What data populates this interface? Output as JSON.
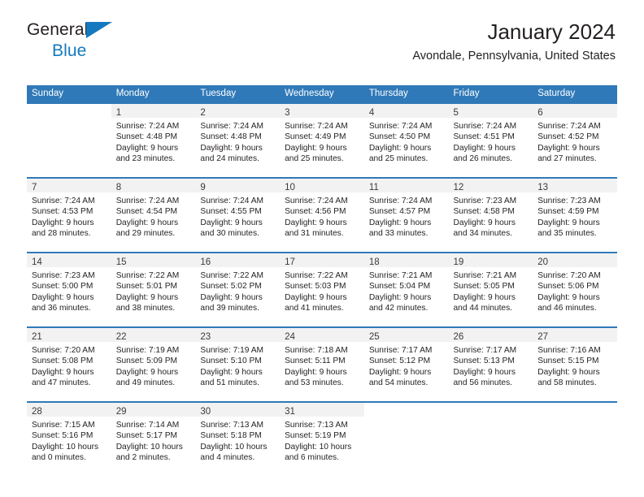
{
  "brand": {
    "name_top": "General",
    "name_bottom": "Blue",
    "triangle_icon": "blue-triangle-icon",
    "color_dark": "#231f20",
    "color_blue": "#1579c0"
  },
  "header": {
    "title": "January 2024",
    "subtitle": "Avondale, Pennsylvania, United States"
  },
  "theme": {
    "header_bg": "#3079b8",
    "header_text": "#ffffff",
    "daynum_band": "#f2f2f2",
    "row_rule": "#3079b8"
  },
  "weekday_headers": [
    "Sunday",
    "Monday",
    "Tuesday",
    "Wednesday",
    "Thursday",
    "Friday",
    "Saturday"
  ],
  "labels": {
    "sunrise": "Sunrise:",
    "sunset": "Sunset:",
    "daylight": "Daylight:"
  },
  "weeks": [
    [
      {
        "day": "",
        "lines": []
      },
      {
        "day": "1",
        "lines": [
          "Sunrise: 7:24 AM",
          "Sunset: 4:48 PM",
          "Daylight: 9 hours",
          "and 23 minutes."
        ]
      },
      {
        "day": "2",
        "lines": [
          "Sunrise: 7:24 AM",
          "Sunset: 4:48 PM",
          "Daylight: 9 hours",
          "and 24 minutes."
        ]
      },
      {
        "day": "3",
        "lines": [
          "Sunrise: 7:24 AM",
          "Sunset: 4:49 PM",
          "Daylight: 9 hours",
          "and 25 minutes."
        ]
      },
      {
        "day": "4",
        "lines": [
          "Sunrise: 7:24 AM",
          "Sunset: 4:50 PM",
          "Daylight: 9 hours",
          "and 25 minutes."
        ]
      },
      {
        "day": "5",
        "lines": [
          "Sunrise: 7:24 AM",
          "Sunset: 4:51 PM",
          "Daylight: 9 hours",
          "and 26 minutes."
        ]
      },
      {
        "day": "6",
        "lines": [
          "Sunrise: 7:24 AM",
          "Sunset: 4:52 PM",
          "Daylight: 9 hours",
          "and 27 minutes."
        ]
      }
    ],
    [
      {
        "day": "7",
        "lines": [
          "Sunrise: 7:24 AM",
          "Sunset: 4:53 PM",
          "Daylight: 9 hours",
          "and 28 minutes."
        ]
      },
      {
        "day": "8",
        "lines": [
          "Sunrise: 7:24 AM",
          "Sunset: 4:54 PM",
          "Daylight: 9 hours",
          "and 29 minutes."
        ]
      },
      {
        "day": "9",
        "lines": [
          "Sunrise: 7:24 AM",
          "Sunset: 4:55 PM",
          "Daylight: 9 hours",
          "and 30 minutes."
        ]
      },
      {
        "day": "10",
        "lines": [
          "Sunrise: 7:24 AM",
          "Sunset: 4:56 PM",
          "Daylight: 9 hours",
          "and 31 minutes."
        ]
      },
      {
        "day": "11",
        "lines": [
          "Sunrise: 7:24 AM",
          "Sunset: 4:57 PM",
          "Daylight: 9 hours",
          "and 33 minutes."
        ]
      },
      {
        "day": "12",
        "lines": [
          "Sunrise: 7:23 AM",
          "Sunset: 4:58 PM",
          "Daylight: 9 hours",
          "and 34 minutes."
        ]
      },
      {
        "day": "13",
        "lines": [
          "Sunrise: 7:23 AM",
          "Sunset: 4:59 PM",
          "Daylight: 9 hours",
          "and 35 minutes."
        ]
      }
    ],
    [
      {
        "day": "14",
        "lines": [
          "Sunrise: 7:23 AM",
          "Sunset: 5:00 PM",
          "Daylight: 9 hours",
          "and 36 minutes."
        ]
      },
      {
        "day": "15",
        "lines": [
          "Sunrise: 7:22 AM",
          "Sunset: 5:01 PM",
          "Daylight: 9 hours",
          "and 38 minutes."
        ]
      },
      {
        "day": "16",
        "lines": [
          "Sunrise: 7:22 AM",
          "Sunset: 5:02 PM",
          "Daylight: 9 hours",
          "and 39 minutes."
        ]
      },
      {
        "day": "17",
        "lines": [
          "Sunrise: 7:22 AM",
          "Sunset: 5:03 PM",
          "Daylight: 9 hours",
          "and 41 minutes."
        ]
      },
      {
        "day": "18",
        "lines": [
          "Sunrise: 7:21 AM",
          "Sunset: 5:04 PM",
          "Daylight: 9 hours",
          "and 42 minutes."
        ]
      },
      {
        "day": "19",
        "lines": [
          "Sunrise: 7:21 AM",
          "Sunset: 5:05 PM",
          "Daylight: 9 hours",
          "and 44 minutes."
        ]
      },
      {
        "day": "20",
        "lines": [
          "Sunrise: 7:20 AM",
          "Sunset: 5:06 PM",
          "Daylight: 9 hours",
          "and 46 minutes."
        ]
      }
    ],
    [
      {
        "day": "21",
        "lines": [
          "Sunrise: 7:20 AM",
          "Sunset: 5:08 PM",
          "Daylight: 9 hours",
          "and 47 minutes."
        ]
      },
      {
        "day": "22",
        "lines": [
          "Sunrise: 7:19 AM",
          "Sunset: 5:09 PM",
          "Daylight: 9 hours",
          "and 49 minutes."
        ]
      },
      {
        "day": "23",
        "lines": [
          "Sunrise: 7:19 AM",
          "Sunset: 5:10 PM",
          "Daylight: 9 hours",
          "and 51 minutes."
        ]
      },
      {
        "day": "24",
        "lines": [
          "Sunrise: 7:18 AM",
          "Sunset: 5:11 PM",
          "Daylight: 9 hours",
          "and 53 minutes."
        ]
      },
      {
        "day": "25",
        "lines": [
          "Sunrise: 7:17 AM",
          "Sunset: 5:12 PM",
          "Daylight: 9 hours",
          "and 54 minutes."
        ]
      },
      {
        "day": "26",
        "lines": [
          "Sunrise: 7:17 AM",
          "Sunset: 5:13 PM",
          "Daylight: 9 hours",
          "and 56 minutes."
        ]
      },
      {
        "day": "27",
        "lines": [
          "Sunrise: 7:16 AM",
          "Sunset: 5:15 PM",
          "Daylight: 9 hours",
          "and 58 minutes."
        ]
      }
    ],
    [
      {
        "day": "28",
        "lines": [
          "Sunrise: 7:15 AM",
          "Sunset: 5:16 PM",
          "Daylight: 10 hours",
          "and 0 minutes."
        ]
      },
      {
        "day": "29",
        "lines": [
          "Sunrise: 7:14 AM",
          "Sunset: 5:17 PM",
          "Daylight: 10 hours",
          "and 2 minutes."
        ]
      },
      {
        "day": "30",
        "lines": [
          "Sunrise: 7:13 AM",
          "Sunset: 5:18 PM",
          "Daylight: 10 hours",
          "and 4 minutes."
        ]
      },
      {
        "day": "31",
        "lines": [
          "Sunrise: 7:13 AM",
          "Sunset: 5:19 PM",
          "Daylight: 10 hours",
          "and 6 minutes."
        ]
      },
      {
        "day": "",
        "lines": []
      },
      {
        "day": "",
        "lines": []
      },
      {
        "day": "",
        "lines": []
      }
    ]
  ]
}
